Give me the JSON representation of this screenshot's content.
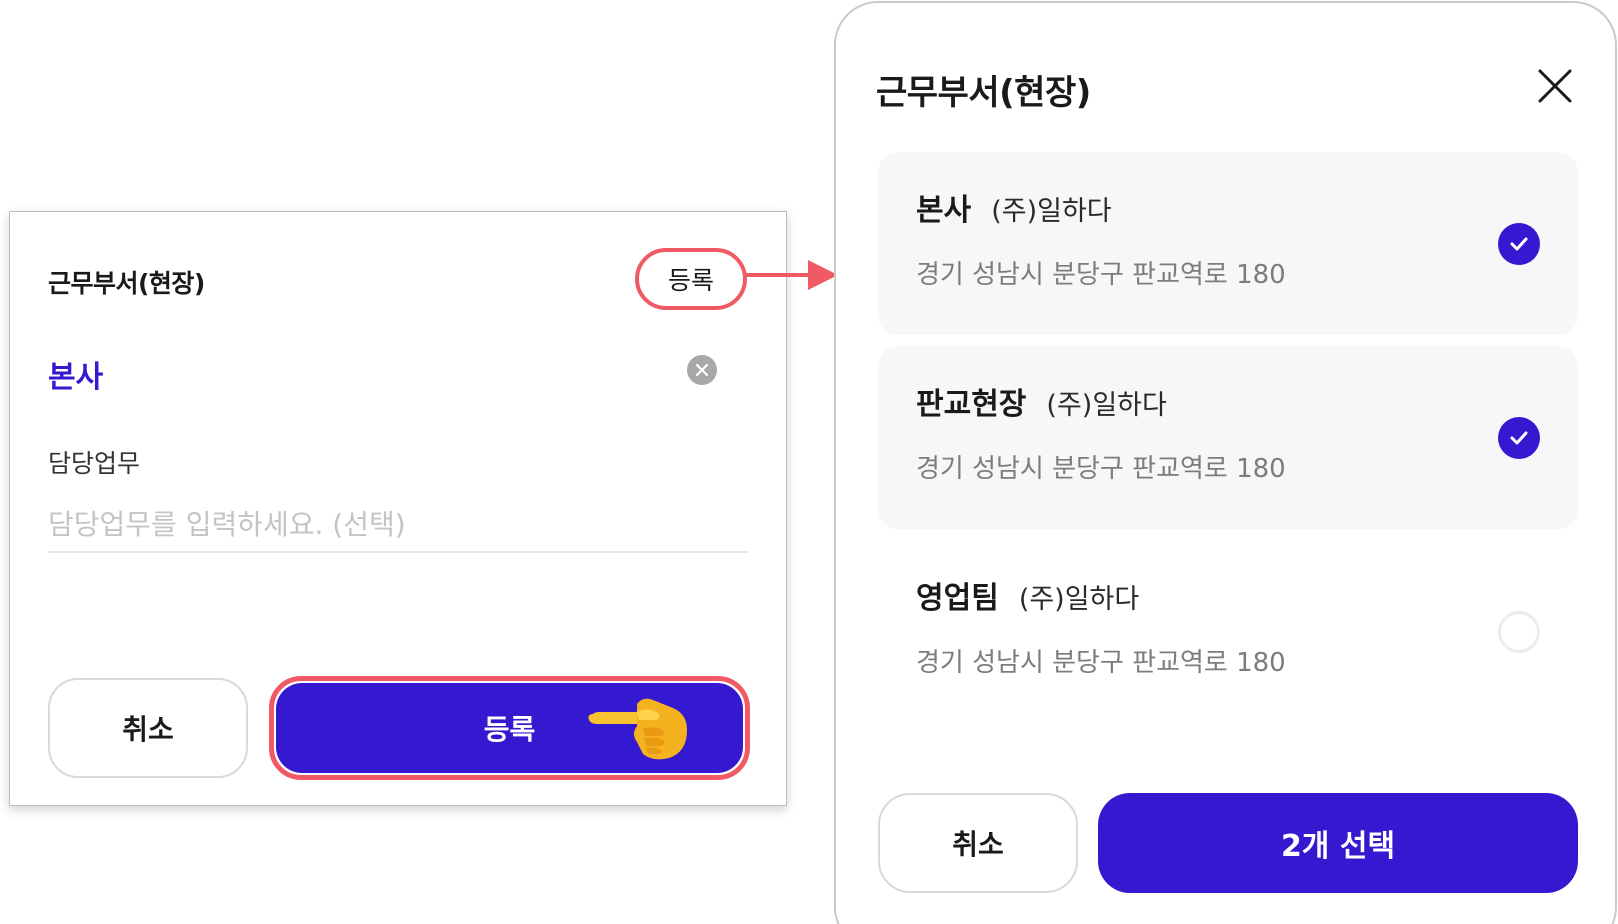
{
  "form": {
    "title": "근무부서(현장)",
    "register_link": "등록",
    "selected_value": "본사",
    "duty_label": "담당업무",
    "duty_placeholder": "담당업무를 입력하세요. (선택)",
    "cancel_label": "취소",
    "submit_label": "등록"
  },
  "modal": {
    "title": "근무부서(현장)",
    "options": [
      {
        "name": "본사",
        "company": "(주)일하다",
        "address": "경기 성남시 분당구 판교역로 180",
        "checked": true
      },
      {
        "name": "판교현장",
        "company": "(주)일하다",
        "address": "경기 성남시 분당구 판교역로 180",
        "checked": true
      },
      {
        "name": "영업팀",
        "company": "(주)일하다",
        "address": "경기 성남시 분당구 판교역로 180",
        "checked": false
      }
    ],
    "cancel_label": "취소",
    "confirm_label": "2개 선택"
  },
  "colors": {
    "primary": "#3519d1",
    "highlight": "#f05a64",
    "selected_bg": "#f6f7f9",
    "muted_text": "#7c7c7c",
    "placeholder": "#c4c4c4"
  },
  "icons": [
    "clear-icon",
    "close-icon",
    "check-icon",
    "pointing-hand-icon",
    "arrow-right-icon"
  ]
}
